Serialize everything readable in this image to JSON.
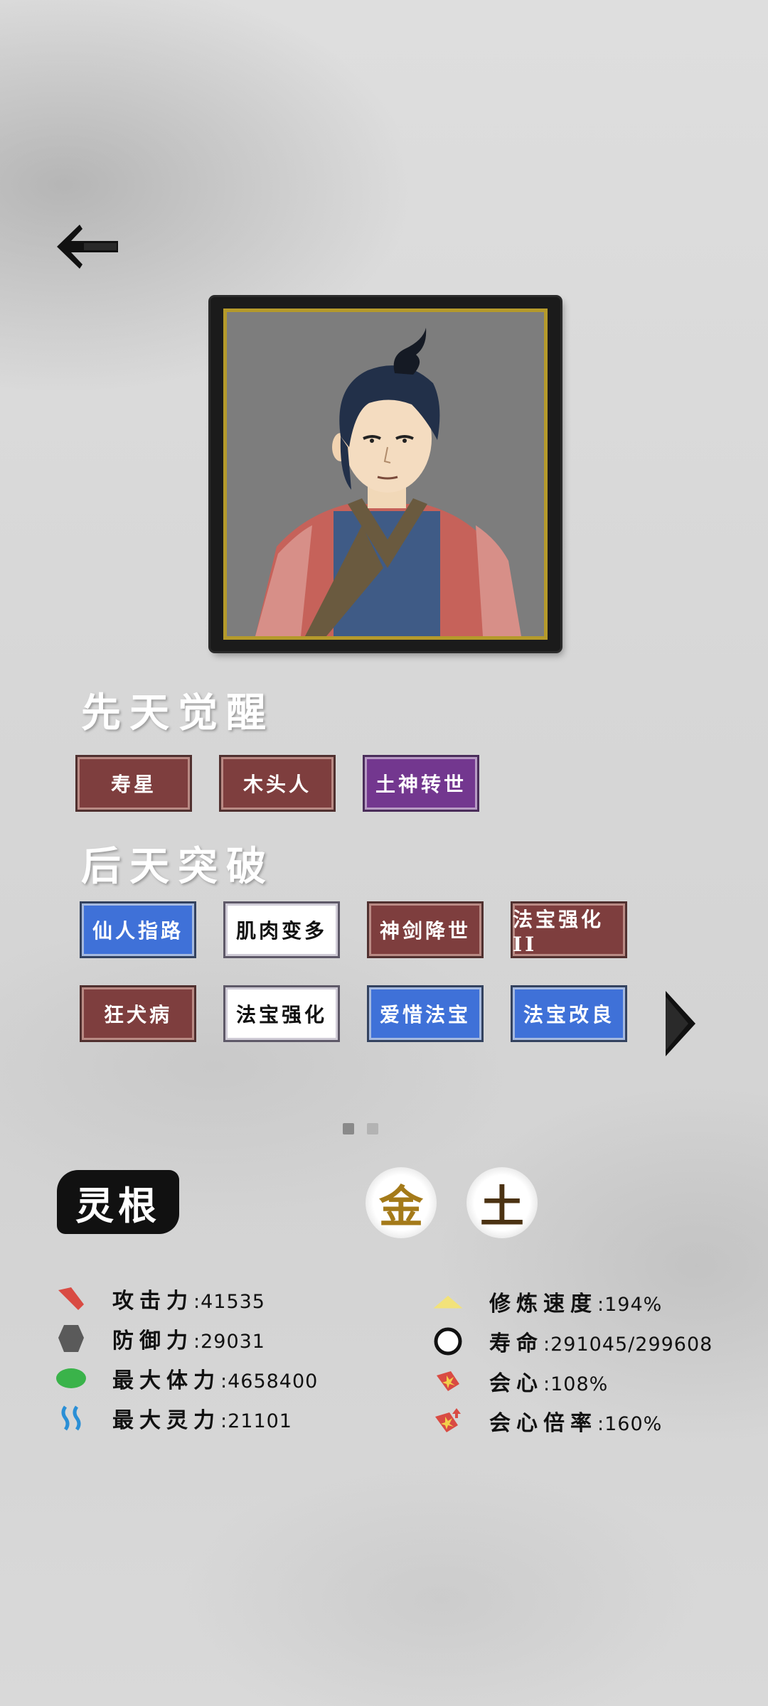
{
  "header": {
    "back_icon": "left-arrow-icon"
  },
  "portrait": {
    "description_icon": "character-portrait"
  },
  "innate": {
    "title": "先天觉醒",
    "traits": [
      {
        "label": "寿星",
        "color": "#7e3e3e"
      },
      {
        "label": "木头人",
        "color": "#7e3e3e"
      },
      {
        "label": "土神转世",
        "color": "#73378f"
      }
    ]
  },
  "acquired": {
    "title": "后天突破",
    "traits": [
      {
        "label": "仙人指路",
        "color": "#3f71d8"
      },
      {
        "label": "肌肉变多",
        "color": "#ffffff"
      },
      {
        "label": "神剑降世",
        "color": "#7e3e3e"
      },
      {
        "label": "法宝强化 II",
        "color": "#7e3e3e"
      },
      {
        "label": "狂犬病",
        "color": "#7e3e3e"
      },
      {
        "label": "法宝强化",
        "color": "#ffffff"
      },
      {
        "label": "爱惜法宝",
        "color": "#3f71d8"
      },
      {
        "label": "法宝改良",
        "color": "#3f71d8"
      }
    ],
    "next_icon": "right-triangle-icon"
  },
  "pagination": {
    "current": 1,
    "total": 2
  },
  "spirit_root": {
    "label": "灵根",
    "elements": [
      "金",
      "土"
    ]
  },
  "stats": {
    "left": [
      {
        "label": "攻击力",
        "value": ":41535",
        "icon": "attack-icon",
        "color": "#d94b43"
      },
      {
        "label": "防御力",
        "value": ":29031",
        "icon": "defense-icon",
        "color": "#5a5a5a"
      },
      {
        "label": "最大体力",
        "value": ":4658400",
        "icon": "health-icon",
        "color": "#3ab34a"
      },
      {
        "label": "最大灵力",
        "value": ":21101",
        "icon": "spirit-icon",
        "color": "#2a8fd6"
      }
    ],
    "right": [
      {
        "label": "修炼速度",
        "value": ":194%",
        "icon": "cultivation-speed-icon",
        "color": "#f2e27a"
      },
      {
        "label": "寿命",
        "value": ":291045/299608",
        "icon": "lifespan-icon",
        "color": "#111111"
      },
      {
        "label": "会心",
        "value": ":108%",
        "icon": "critical-icon",
        "color": "#d94b43"
      },
      {
        "label": "会心倍率",
        "value": ":160%",
        "icon": "critical-multiplier-icon",
        "color": "#d94b43"
      }
    ]
  }
}
